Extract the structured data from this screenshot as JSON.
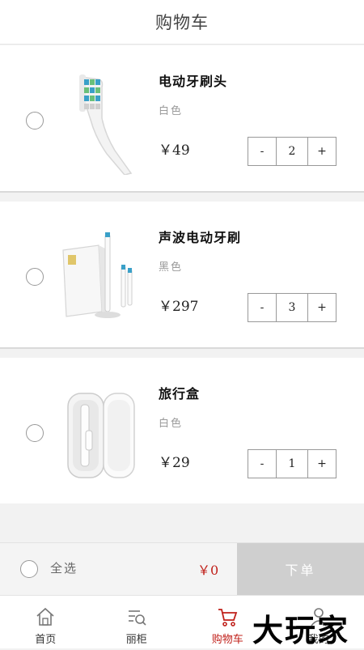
{
  "header": {
    "title": "购物车"
  },
  "cart": {
    "items": [
      {
        "name": "电动牙刷头",
        "color": "白色",
        "price": "￥49",
        "qty": "2"
      },
      {
        "name": "声波电动牙刷",
        "color": "黑色",
        "price": "￥297",
        "qty": "3"
      },
      {
        "name": "旅行盒",
        "color": "白色",
        "price": "￥29",
        "qty": "1"
      }
    ],
    "minus_label": "-",
    "plus_label": "+"
  },
  "footer": {
    "select_all_label": "全选",
    "total": "￥0",
    "order_button": "下单"
  },
  "tabbar": {
    "items": [
      {
        "label": "首页",
        "icon": "home-icon"
      },
      {
        "label": "丽柜",
        "icon": "list-search-icon"
      },
      {
        "label": "购物车",
        "icon": "cart-icon"
      },
      {
        "label": "我的",
        "icon": "profile-icon"
      }
    ],
    "active": "购物车"
  },
  "watermark": "大玩家",
  "colors": {
    "accent": "#c0201a",
    "order_button_bg": "#cfcfcf"
  }
}
